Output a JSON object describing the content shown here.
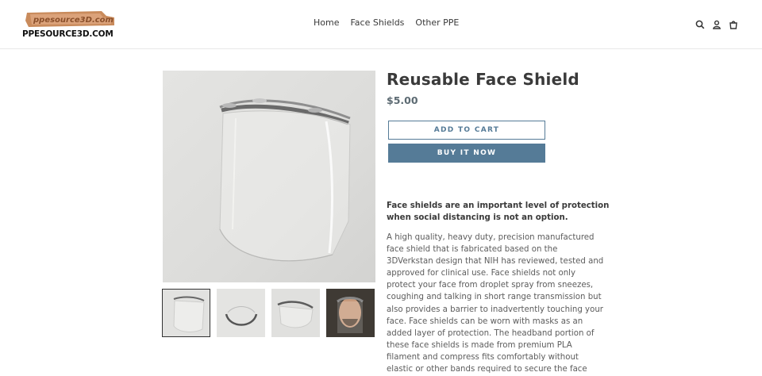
{
  "header": {
    "logo_text": "PPESOURCE3D.COM",
    "logo_art_text": "ppesource3D.com",
    "nav": [
      "Home",
      "Face Shields",
      "Other PPE"
    ],
    "icons": [
      "search-icon",
      "account-icon",
      "cart-icon"
    ]
  },
  "product": {
    "title": "Reusable Face Shield",
    "price": "$5.00",
    "add_to_cart_label": "ADD TO CART",
    "buy_now_label": "BUY IT NOW",
    "description_lead_lines": [
      "Face shields are an important level of protection",
      "when social distancing is not an option."
    ],
    "description_lines": [
      "A high quality, heavy duty, precision manufactured",
      "face shield that is fabricated based on the",
      "3DVerkstan design that NIH has reviewed, tested and",
      "approved for clinical use. Face shields not only",
      "protect your face from droplet spray from sneezes,",
      "coughing and talking in short range transmission but",
      "also provides a barrier to inadvertently touching your",
      "face. Face shields can be worn with masks as an",
      "added layer of protection. The headband portion of",
      "these face shields is made from premium PLA",
      "filament and compress fits comfortably without",
      "elastic or other bands required to secure the face"
    ]
  },
  "gallery": {
    "thumbnails": [
      "thumbnail-front",
      "thumbnail-top",
      "thumbnail-side",
      "thumbnail-worn"
    ],
    "selected_index": 0
  },
  "colors": {
    "accent": "#557b97",
    "price": "#5c6a72",
    "text": "#3a3a3a"
  }
}
